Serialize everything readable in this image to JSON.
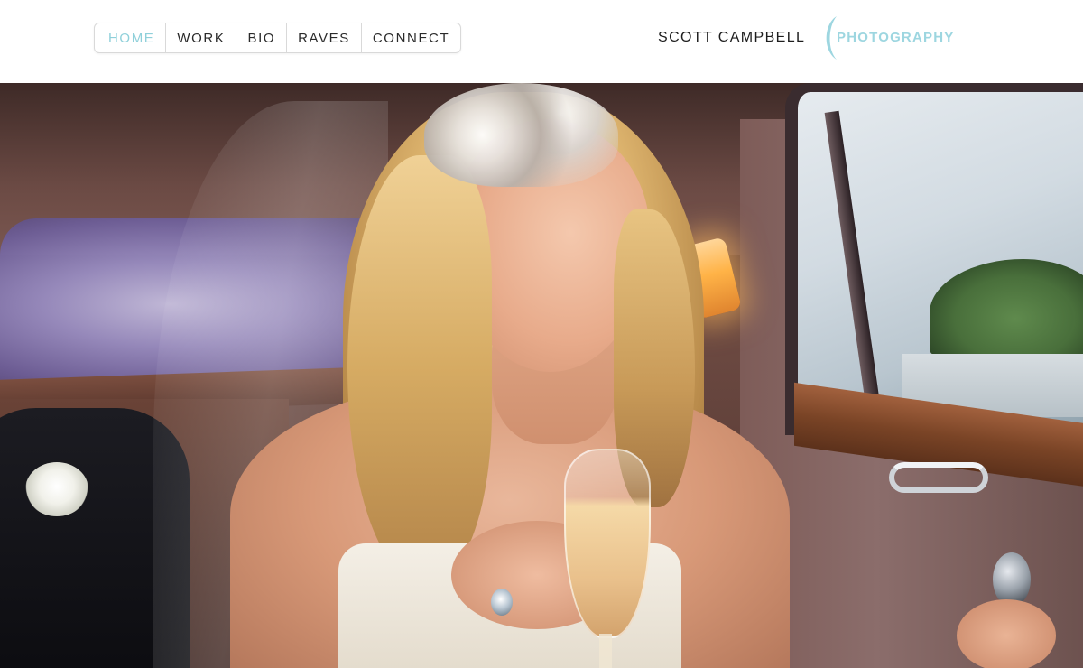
{
  "nav": {
    "items": [
      {
        "label": "HOME",
        "active": true
      },
      {
        "label": "WORK",
        "active": false
      },
      {
        "label": "BIO",
        "active": false
      },
      {
        "label": "RAVES",
        "active": false
      },
      {
        "label": "CONNECT",
        "active": false
      }
    ],
    "active_color": "#8fd0da"
  },
  "brand": {
    "name": "SCOTT CAMPBELL",
    "sub": "PHOTOGRAPHY",
    "accent_color": "#9dd6e0"
  },
  "hero": {
    "subject": "bride-in-car-photo"
  }
}
